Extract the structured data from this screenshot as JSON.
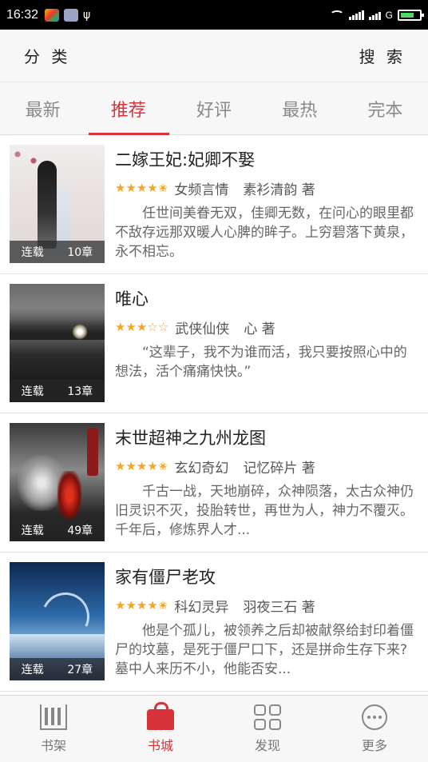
{
  "status_bar": {
    "time": "16:32",
    "network": "G"
  },
  "header": {
    "left_label": "分 类",
    "right_label": "搜 索"
  },
  "tabs": [
    {
      "label": "最新",
      "active": false
    },
    {
      "label": "推荐",
      "active": true
    },
    {
      "label": "好评",
      "active": false
    },
    {
      "label": "最热",
      "active": false
    },
    {
      "label": "完本",
      "active": false
    }
  ],
  "books": [
    {
      "title": "二嫁王妃:妃卿不娶",
      "rating": 4.5,
      "stars": "★★★★✬",
      "genre": "女频言情",
      "author": "素衫清韵 著",
      "status": "连载",
      "chapters": "10章",
      "description": "任世间美眷无双，佳卿无数，在问心的眼里都不敌存远那双暖人心脾的眸子。上穷碧落下黄泉，永不相忘。"
    },
    {
      "title": "唯心",
      "rating": 3,
      "stars": "★★★☆☆",
      "genre": "武侠仙侠",
      "author": "心 著",
      "status": "连载",
      "chapters": "13章",
      "description": "“这辈子，我不为谁而活，我只要按照心中的想法，活个痛痛快快。”"
    },
    {
      "title": "末世超神之九州龙图",
      "rating": 4.5,
      "stars": "★★★★✬",
      "genre": "玄幻奇幻",
      "author": "记忆碎片 著",
      "status": "连载",
      "chapters": "49章",
      "description": "千古一战，天地崩碎，众神陨落，太古众神仍旧灵识不灭，投胎转世，再世为人，神力不覆灭。 千年后，修炼界人才..."
    },
    {
      "title": "家有僵尸老攻",
      "rating": 4.5,
      "stars": "★★★★✬",
      "genre": "科幻灵异",
      "author": "羽夜三石 著",
      "status": "连载",
      "chapters": "27章",
      "description": "他是个孤儿，被领养之后却被献祭给封印着僵尸的坟墓，是死于僵尸口下，还是拼命生存下来? 墓中人来历不小，他能否安..."
    }
  ],
  "bottom_nav": [
    {
      "label": "书架",
      "icon": "bookshelf-icon",
      "active": false
    },
    {
      "label": "书城",
      "icon": "bookstore-bag-icon",
      "active": true
    },
    {
      "label": "发现",
      "icon": "discover-grid-icon",
      "active": false
    },
    {
      "label": "更多",
      "icon": "more-dots-icon",
      "active": false
    }
  ],
  "colors": {
    "accent": "#d6333a",
    "star": "#f5a623"
  }
}
